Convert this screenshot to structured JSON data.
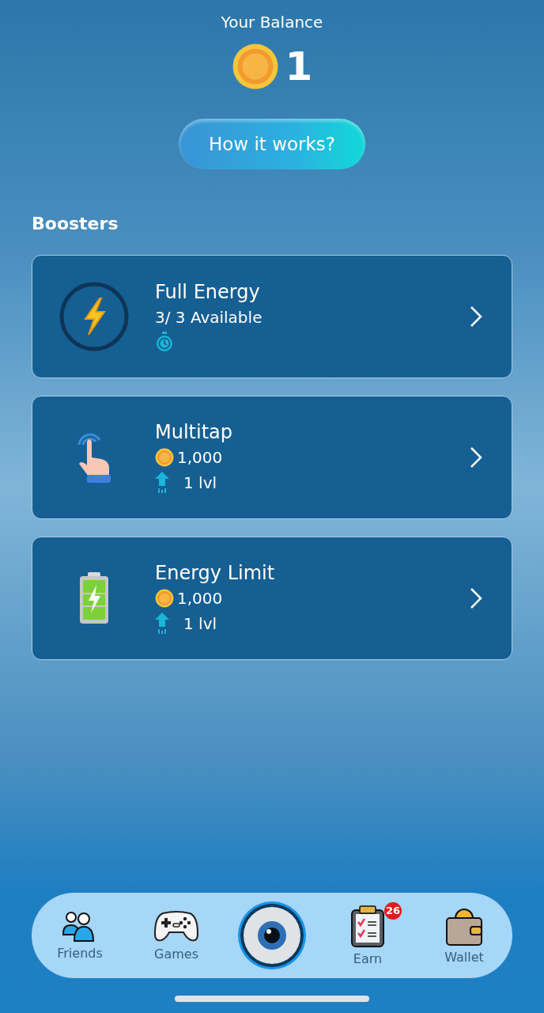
{
  "balance": {
    "label": "Your Balance",
    "amount": "1"
  },
  "how_button": {
    "label": "How it works?"
  },
  "boosters": {
    "title": "Boosters",
    "items": [
      {
        "kind": "full-energy",
        "title": "Full Energy",
        "available": "3/ 3 Available"
      },
      {
        "kind": "multitap",
        "title": "Multitap",
        "price": "1,000",
        "level": "1 lvl"
      },
      {
        "kind": "energy-limit",
        "title": "Energy Limit",
        "price": "1,000",
        "level": "1 lvl"
      }
    ]
  },
  "nav": [
    {
      "kind": "friends",
      "label": "Friends"
    },
    {
      "kind": "games",
      "label": "Games"
    },
    {
      "kind": "eye"
    },
    {
      "kind": "earn",
      "label": "Earn",
      "badge": "26"
    },
    {
      "kind": "wallet",
      "label": "Wallet"
    }
  ]
}
